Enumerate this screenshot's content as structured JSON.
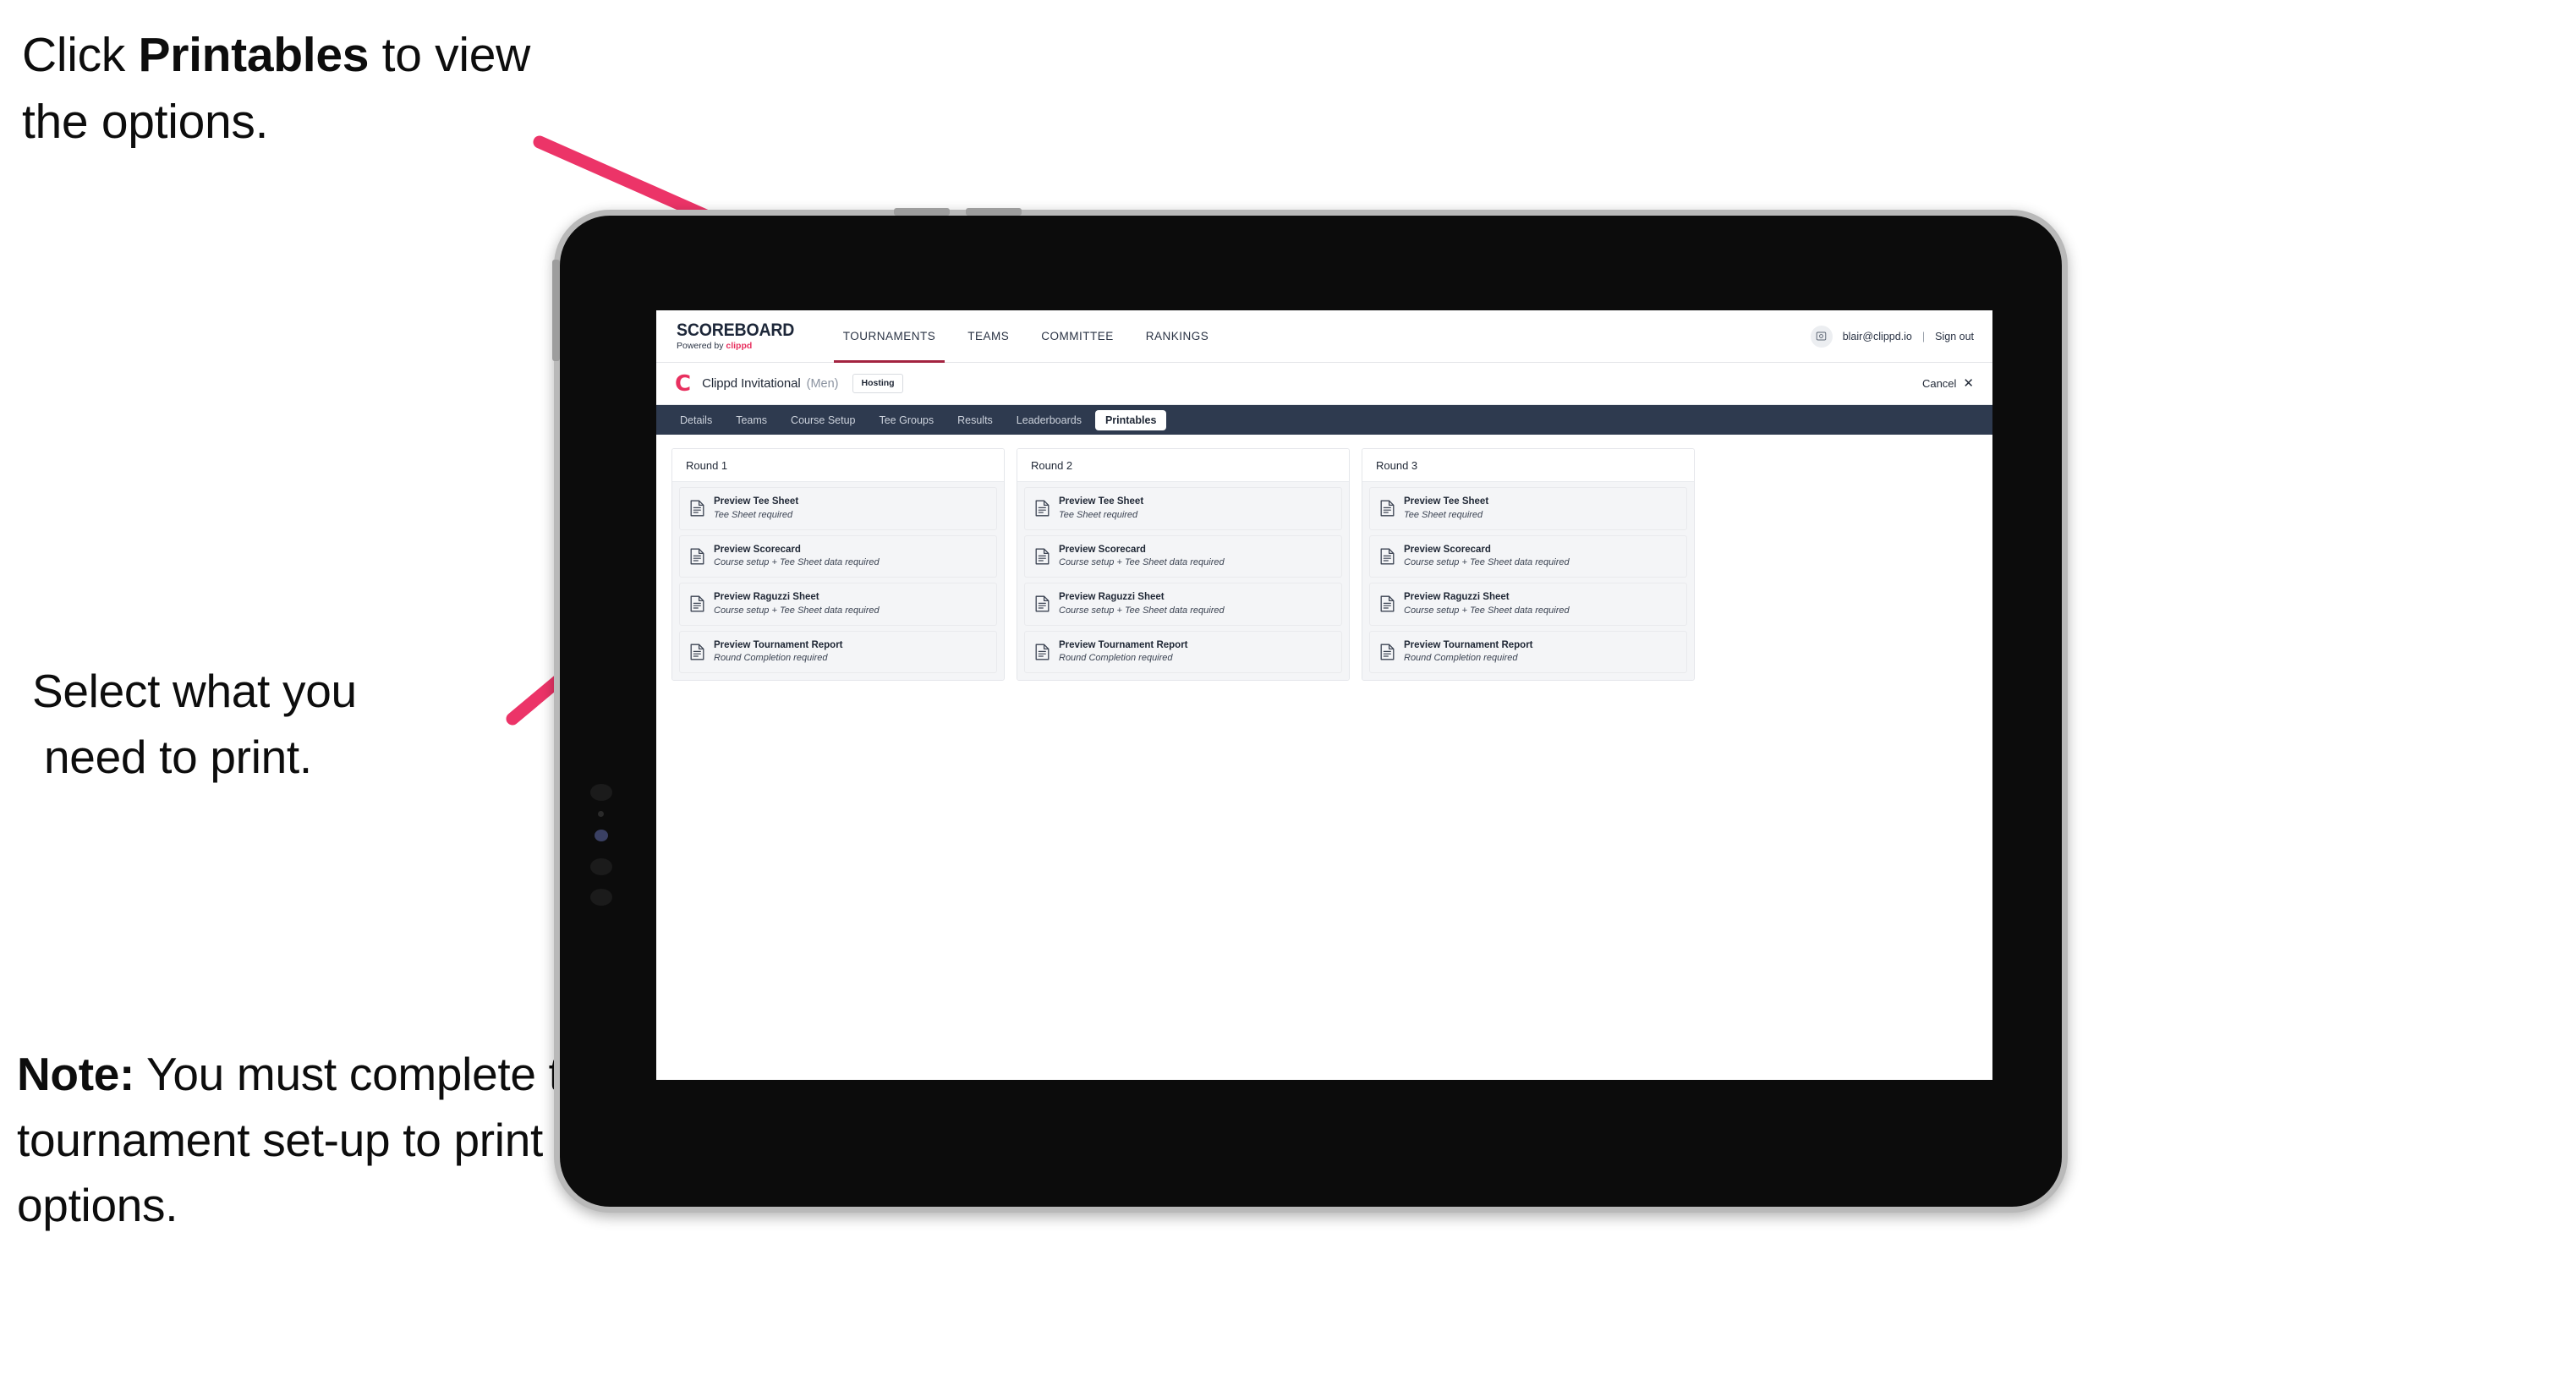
{
  "annotations": {
    "top": {
      "pre": "Click ",
      "bold": "Printables",
      "post": " to view the options."
    },
    "middle": {
      "line1": "Select what you",
      "line2": "need to print."
    },
    "note": {
      "bold": "Note:",
      "text": " You must complete the tournament set-up to print all the options."
    }
  },
  "app": {
    "logo": {
      "word": "SCOREBOARD",
      "powered_by": "Powered by ",
      "brand": "clippd"
    },
    "topnav": [
      {
        "label": "TOURNAMENTS",
        "active": true
      },
      {
        "label": "TEAMS",
        "active": false
      },
      {
        "label": "COMMITTEE",
        "active": false
      },
      {
        "label": "RANKINGS",
        "active": false
      }
    ],
    "user": {
      "email": "blair@clippd.io",
      "separator": "|",
      "sign_out": "Sign out",
      "avatar_icon": "user-avatar-icon"
    },
    "tournament": {
      "logo_letter": "C",
      "name": "Clippd Invitational",
      "gender": "(Men)",
      "status_badge": "Hosting",
      "cancel_label": "Cancel",
      "cancel_icon": "close-icon"
    },
    "subnav": [
      {
        "label": "Details",
        "active": false
      },
      {
        "label": "Teams",
        "active": false
      },
      {
        "label": "Course Setup",
        "active": false
      },
      {
        "label": "Tee Groups",
        "active": false
      },
      {
        "label": "Results",
        "active": false
      },
      {
        "label": "Leaderboards",
        "active": false
      },
      {
        "label": "Printables",
        "active": true
      }
    ],
    "rounds": [
      {
        "title": "Round 1",
        "items": [
          {
            "title": "Preview Tee Sheet",
            "subtitle": "Tee Sheet required",
            "icon": "document-icon"
          },
          {
            "title": "Preview Scorecard",
            "subtitle": "Course setup + Tee Sheet data required",
            "icon": "document-icon"
          },
          {
            "title": "Preview Raguzzi Sheet",
            "subtitle": "Course setup + Tee Sheet data required",
            "icon": "document-icon"
          },
          {
            "title": "Preview Tournament Report",
            "subtitle": "Round Completion required",
            "icon": "document-icon"
          }
        ]
      },
      {
        "title": "Round 2",
        "items": [
          {
            "title": "Preview Tee Sheet",
            "subtitle": "Tee Sheet required",
            "icon": "document-icon"
          },
          {
            "title": "Preview Scorecard",
            "subtitle": "Course setup + Tee Sheet data required",
            "icon": "document-icon"
          },
          {
            "title": "Preview Raguzzi Sheet",
            "subtitle": "Course setup + Tee Sheet data required",
            "icon": "document-icon"
          },
          {
            "title": "Preview Tournament Report",
            "subtitle": "Round Completion required",
            "icon": "document-icon"
          }
        ]
      },
      {
        "title": "Round 3",
        "items": [
          {
            "title": "Preview Tee Sheet",
            "subtitle": "Tee Sheet required",
            "icon": "document-icon"
          },
          {
            "title": "Preview Scorecard",
            "subtitle": "Course setup + Tee Sheet data required",
            "icon": "document-icon"
          },
          {
            "title": "Preview Raguzzi Sheet",
            "subtitle": "Course setup + Tee Sheet data required",
            "icon": "document-icon"
          },
          {
            "title": "Preview Tournament Report",
            "subtitle": "Round Completion required",
            "icon": "document-icon"
          }
        ]
      }
    ]
  },
  "colors": {
    "accent_pink": "#e8305f",
    "arrow_pink": "#ec3468",
    "subnav_navy": "#2e3a4f",
    "active_underline": "#a32340",
    "text_dark": "#1f2735"
  }
}
